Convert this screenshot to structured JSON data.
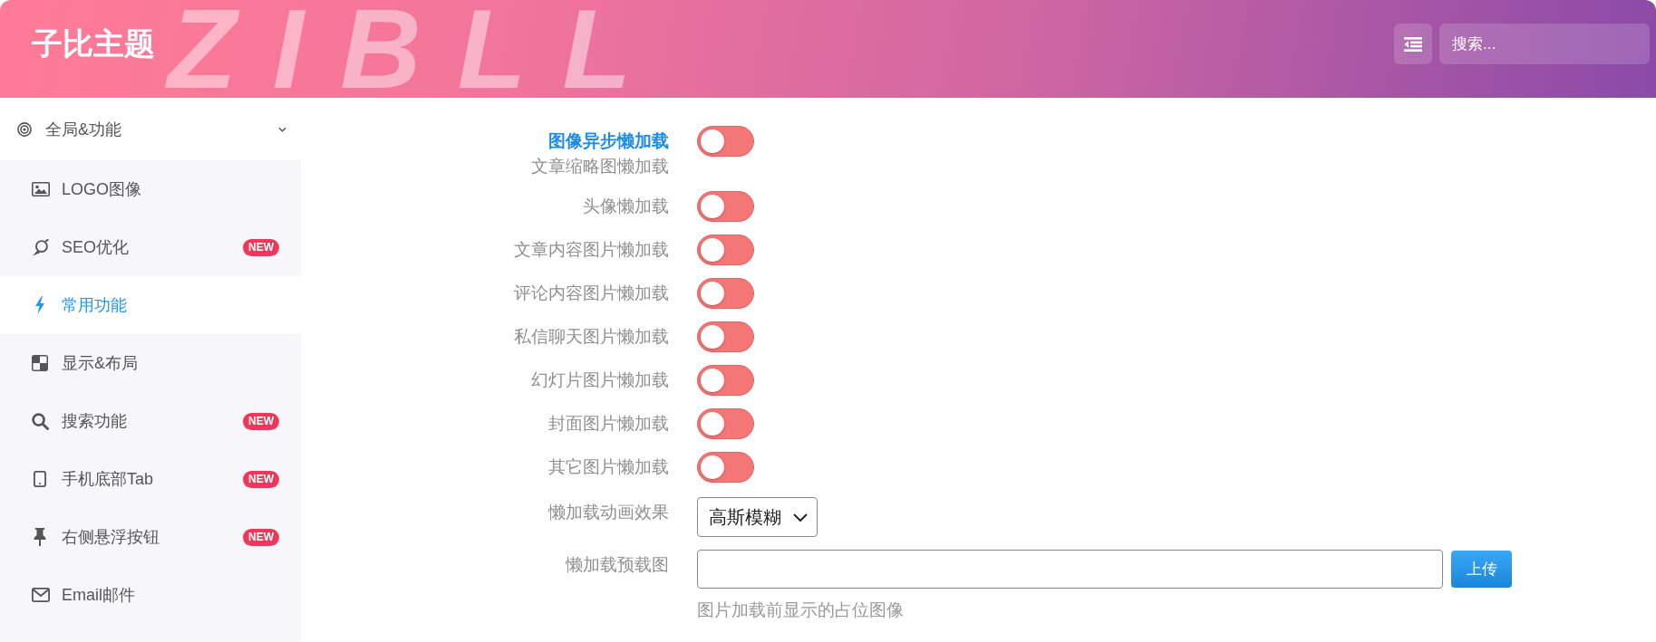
{
  "header": {
    "title": "子比主题",
    "backdrop_text": "ZIBLL",
    "search": {
      "placeholder": "搜索..."
    }
  },
  "sidebar": {
    "groups": [
      {
        "label": "全局&功能",
        "expanded": true,
        "items": [
          {
            "label": "LOGO图像",
            "selected": false
          },
          {
            "label": "SEO优化",
            "selected": false,
            "badge": "NEW"
          },
          {
            "label": "常用功能",
            "selected": true
          },
          {
            "label": "显示&布局",
            "selected": false
          },
          {
            "label": "搜索功能",
            "selected": false,
            "badge": "NEW"
          },
          {
            "label": "手机底部Tab",
            "selected": false,
            "badge": "NEW"
          },
          {
            "label": "右侧悬浮按钮",
            "selected": false,
            "badge": "NEW"
          },
          {
            "label": "Email邮件",
            "selected": false
          }
        ]
      }
    ]
  },
  "form": {
    "fields": [
      {
        "kind": "switch",
        "title": "图像异步懒加载",
        "highlighted": true,
        "subtitle": "文章缩略图懒加载",
        "on": false
      },
      {
        "kind": "switch",
        "title": "头像懒加载",
        "highlighted": false,
        "on": false
      },
      {
        "kind": "switch",
        "title": "文章内容图片懒加载",
        "highlighted": false,
        "on": false
      },
      {
        "kind": "switch",
        "title": "评论内容图片懒加载",
        "highlighted": false,
        "on": false
      },
      {
        "kind": "switch",
        "title": "私信聊天图片懒加载",
        "highlighted": false,
        "on": false
      },
      {
        "kind": "switch",
        "title": "幻灯片图片懒加载",
        "highlighted": false,
        "on": false
      },
      {
        "kind": "switch",
        "title": "封面图片懒加载",
        "highlighted": false,
        "on": false
      },
      {
        "kind": "switch",
        "title": "其它图片懒加载",
        "highlighted": false,
        "on": false
      },
      {
        "kind": "select",
        "title": "懒加载动画效果",
        "highlighted": false,
        "value": "高斯模糊"
      },
      {
        "kind": "upload",
        "title": "懒加载预载图",
        "highlighted": false,
        "button": "上传",
        "help": "图片加载前显示的占位图像"
      }
    ]
  }
}
